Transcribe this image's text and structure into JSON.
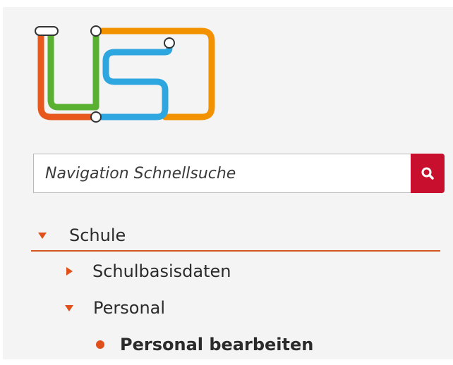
{
  "colors": {
    "accent": "#e0501b",
    "search_button": "#c8102e",
    "logo_orange": "#f39200",
    "logo_red_orange": "#e8581c",
    "logo_green": "#5ab031",
    "logo_blue": "#2ea6df"
  },
  "logo": {
    "text": "USD"
  },
  "search": {
    "placeholder": "Navigation Schnellsuche",
    "value": "",
    "button_icon": "search-icon"
  },
  "nav": {
    "items": [
      {
        "label": "Schule",
        "state": "expanded",
        "level": 0,
        "icon": "caret-down-icon"
      },
      {
        "label": "Schulbasisdaten",
        "state": "collapsed",
        "level": 1,
        "icon": "caret-right-icon"
      },
      {
        "label": "Personal",
        "state": "expanded",
        "level": 1,
        "icon": "caret-down-icon"
      },
      {
        "label": "Personal bearbeiten",
        "state": "active",
        "level": 2,
        "icon": "bullet-icon"
      }
    ]
  }
}
